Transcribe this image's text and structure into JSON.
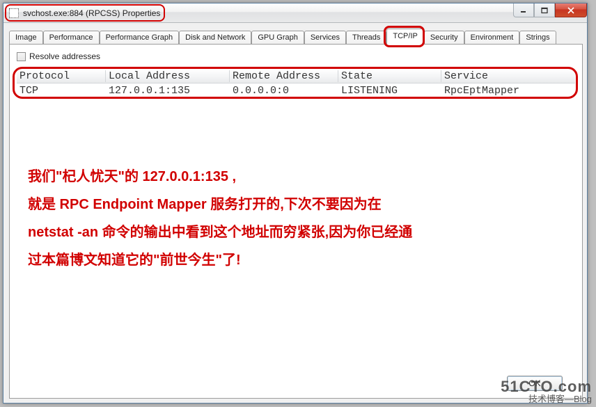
{
  "window": {
    "title": "svchost.exe:884 (RPCSS) Properties"
  },
  "tabs": [
    {
      "label": "Image"
    },
    {
      "label": "Performance"
    },
    {
      "label": "Performance Graph"
    },
    {
      "label": "Disk and Network"
    },
    {
      "label": "GPU Graph"
    },
    {
      "label": "Services"
    },
    {
      "label": "Threads"
    },
    {
      "label": "TCP/IP"
    },
    {
      "label": "Security"
    },
    {
      "label": "Environment"
    },
    {
      "label": "Strings"
    }
  ],
  "active_tab_index": 7,
  "resolve_label": "Resolve addresses",
  "columns": [
    "Protocol",
    "Local Address",
    "Remote Address",
    "State",
    "Service"
  ],
  "rows": [
    {
      "protocol": "TCP",
      "local": "127.0.0.1:135",
      "remote": "0.0.0.0:0",
      "state": "LISTENING",
      "service": "RpcEptMapper"
    }
  ],
  "annotation_lines": [
    "我们\"杞人忧天\"的 127.0.0.1:135 ,",
    "就是 RPC Endpoint Mapper  服务打开的,下次不要因为在",
    "netstat -an 命令的输出中看到这个地址而穷紧张,因为你已经通",
    "过本篇博文知道它的\"前世今生\"了!"
  ],
  "ok_label": "OK",
  "watermark": {
    "line1": "51CTO.com",
    "line2": "技术博客—Blog"
  },
  "colors": {
    "highlight": "#d10000"
  }
}
